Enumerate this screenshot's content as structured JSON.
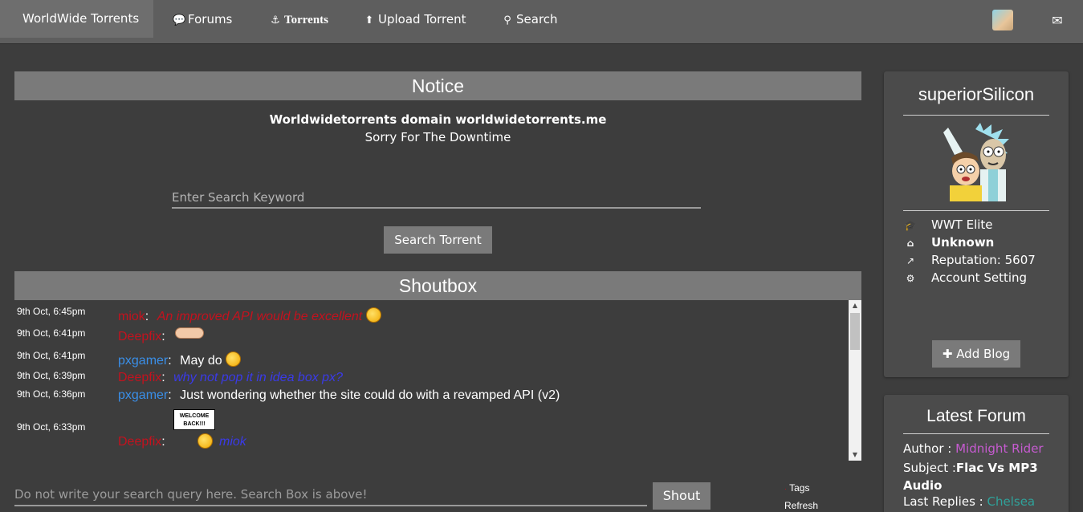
{
  "nav": {
    "brand": "WorldWide Torrents",
    "items": [
      {
        "icon": "comments-icon",
        "label": "Forums"
      },
      {
        "icon": "anchor-icon",
        "label": "Torrents"
      },
      {
        "icon": "upload-icon",
        "label": "Upload Torrent"
      },
      {
        "icon": "search-icon",
        "label": "Search"
      }
    ],
    "right_icons": [
      "user-avatar-icon",
      "envelope-icon"
    ]
  },
  "notice": {
    "title": "Notice",
    "line1": "Worldwidetorrents domain worldwidetorrents.me",
    "line2": "Sorry For The Downtime"
  },
  "search": {
    "placeholder": "Enter Search Keyword",
    "button": "Search Torrent"
  },
  "shoutbox": {
    "title": "Shoutbox",
    "messages": [
      {
        "time": "9th Oct, 6:45pm",
        "user": "miok",
        "user_color": "#c4121e",
        "text": "An improved API would be excellent",
        "style": "red-italic",
        "emoji": "smiley"
      },
      {
        "time": "9th Oct, 6:41pm",
        "user": "Deepfix",
        "user_color": "#c4121e",
        "text": "",
        "style": "none",
        "emoji": "thumbs"
      },
      {
        "time": "9th Oct, 6:41pm",
        "user": "pxgamer",
        "user_color": "#3a8fe8",
        "text": "May do",
        "style": "white",
        "emoji": "smiley"
      },
      {
        "time": "9th Oct, 6:39pm",
        "user": "Deepfix",
        "user_color": "#c4121e",
        "text": "why not pop it in idea box px?",
        "style": "blue-italic",
        "emoji": ""
      },
      {
        "time": "9th Oct, 6:36pm",
        "user": "pxgamer",
        "user_color": "#3a8fe8",
        "text": "Just wondering whether the site could do with a revamped API (v2)",
        "style": "white",
        "emoji": ""
      },
      {
        "time": "9th Oct, 6:33pm",
        "user": "Deepfix",
        "user_color": "#c4121e",
        "text": "miok",
        "style": "blue-italic",
        "emoji": "welcome-sign"
      }
    ],
    "welcome_sign_text": "WELCOME BACK!!!",
    "input_placeholder": "Do not write your search query here. Search Box is above!",
    "shout_button": "Shout",
    "tags_link": "Tags",
    "refresh_link": "Refresh"
  },
  "profile": {
    "username": "superiorSilicon",
    "rows": [
      {
        "icon": "graduation-cap-icon",
        "label": "WWT Elite",
        "bold": false
      },
      {
        "icon": "home-icon",
        "label": "Unknown",
        "bold": true
      },
      {
        "icon": "line-chart-icon",
        "label": "Reputation: 5607",
        "bold": false
      },
      {
        "icon": "gear-icon",
        "label": "Account Setting",
        "bold": false
      }
    ],
    "add_blog": "Add Blog"
  },
  "latest_forum": {
    "title": "Latest Forum",
    "author_label": "Author :",
    "author": "Midnight Rider",
    "subject_label": "Subject :",
    "subject": "Flac Vs MP3 Audio",
    "replies_label": "Last Replies :",
    "last_reply": "Chelsea"
  },
  "colors": {
    "background": "#3d3d3d",
    "navbar": "#5e5e5e",
    "section_header": "#7a7a7a",
    "card": "#4b4b4b",
    "user_red": "#c4121e",
    "user_blue": "#3a8fe8",
    "author_purple": "#c65bd0",
    "reply_teal": "#2fa29a"
  }
}
